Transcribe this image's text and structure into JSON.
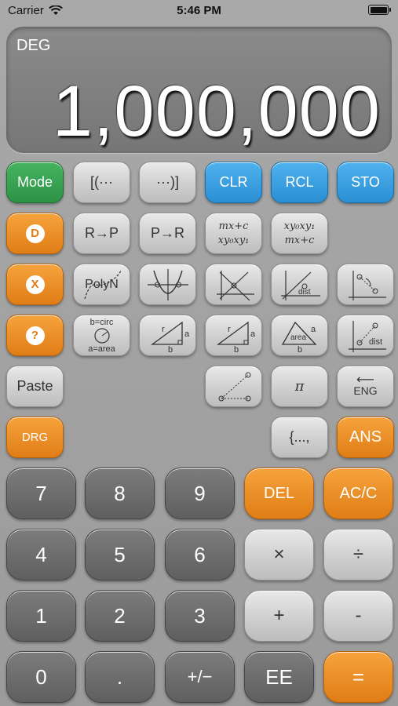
{
  "status_bar": {
    "carrier": "Carrier",
    "time": "5:46 PM"
  },
  "display": {
    "angle_mode": "DEG",
    "value": "1,000,000"
  },
  "row1": {
    "mode": "Mode",
    "open_paren": "[(···",
    "close_paren": "···)]",
    "clr": "CLR",
    "rcl": "RCL",
    "sto": "STO"
  },
  "row2": {
    "d_icon": "D",
    "r_to_p": "R→P",
    "p_to_r": "P→R",
    "line_fit_top": "mx+c",
    "line_fit_bottom": "xy₀xy₁",
    "line_from_points_top": "xy₀xy₁",
    "line_from_points_bottom": "mx+c"
  },
  "row3": {
    "x_icon": "X",
    "polyn": "PolyN",
    "dist": "dist"
  },
  "row4": {
    "q_icon": "?",
    "circle_top": "b=circ",
    "circle_mid": "r",
    "circle_bottom": "a=area",
    "tri1_label_b": "b",
    "tri1_label_a": "a",
    "tri1_label_r": "r",
    "tri2_label_b": "b",
    "tri2_label_a": "a",
    "tri2_label_r": "r",
    "tri3_label_area": "area",
    "tri3_label_a": "a",
    "tri3_label_b": "b",
    "dist2": "dist"
  },
  "row5": {
    "paste": "Paste",
    "pi": "π",
    "eng": "ENG"
  },
  "row6": {
    "drg": "DRG",
    "list": "{...,",
    "ans": "ANS"
  },
  "keypad": {
    "k7": "7",
    "k8": "8",
    "k9": "9",
    "del": "DEL",
    "ac": "AC/C",
    "k4": "4",
    "k5": "5",
    "k6": "6",
    "mul": "×",
    "div": "÷",
    "k1": "1",
    "k2": "2",
    "k3": "3",
    "add": "+",
    "sub": "-",
    "k0": "0",
    "dot": ".",
    "neg": "+/−",
    "ee": "EE",
    "eq": "="
  }
}
